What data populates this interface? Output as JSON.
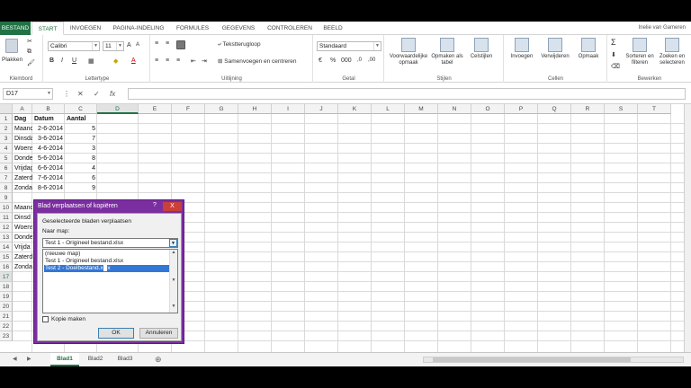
{
  "ribbon_tabs": [
    "BESTAND",
    "START",
    "INVOEGEN",
    "PAGINA-INDELING",
    "FORMULES",
    "GEGEVENS",
    "CONTROLEREN",
    "BEELD"
  ],
  "user_name": "Inelie van Gameren",
  "ribbon": {
    "clipboard": {
      "paste": "Plakken",
      "label": "Klembord"
    },
    "font": {
      "name": "Calibri",
      "size": "11",
      "label": "Lettertype"
    },
    "alignment": {
      "wrap": "Tekstterugloop",
      "merge": "Samenvoegen en centreren",
      "label": "Uitlijning"
    },
    "number": {
      "format": "Standaard",
      "label": "Getal"
    },
    "styles": {
      "conditional": "Voorwaardelijke opmaak",
      "table": "Opmaken als tabel",
      "cell": "Celstijlen",
      "label": "Stijlen"
    },
    "cells": {
      "insert": "Invoegen",
      "delete": "Verwijderen",
      "format": "Opmaak",
      "label": "Cellen"
    },
    "editing": {
      "sort": "Sorteren en filteren",
      "find": "Zoeken en selecteren",
      "label": "Bewerken"
    }
  },
  "formula_bar": {
    "name_box": "D17",
    "formula": ""
  },
  "columns": [
    "A",
    "B",
    "C",
    "D",
    "E",
    "F",
    "G",
    "H",
    "I",
    "J",
    "K",
    "L",
    "M",
    "N",
    "O",
    "P",
    "Q",
    "R",
    "S",
    "T"
  ],
  "rows": [
    "1",
    "2",
    "3",
    "4",
    "5",
    "6",
    "7",
    "8",
    "9",
    "10",
    "11",
    "12",
    "13",
    "14",
    "15",
    "16",
    "17",
    "18",
    "19",
    "20",
    "21",
    "22",
    "23"
  ],
  "table1": {
    "headers": [
      "Dag",
      "Datum",
      "Aantal"
    ],
    "rows": [
      [
        "Maandag",
        "2-6-2014",
        "5"
      ],
      [
        "Dinsdag",
        "3-6-2014",
        "7"
      ],
      [
        "Woensdag",
        "4-6-2014",
        "3"
      ],
      [
        "Donderdag",
        "5-6-2014",
        "8"
      ],
      [
        "Vrijdag",
        "6-6-2014",
        "4"
      ],
      [
        "Zaterdag",
        "7-6-2014",
        "6"
      ],
      [
        "Zondag",
        "8-6-2014",
        "9"
      ]
    ]
  },
  "table2_partial": [
    "Maand",
    "Dinsd",
    "Woens",
    "Donde",
    "Vrijda",
    "Zaterd",
    "Zonda"
  ],
  "sheets": [
    "Blad1",
    "Blad2",
    "Blad3"
  ],
  "active_sheet": "Blad1",
  "dialog": {
    "title": "Blad verplaatsen of kopiëren",
    "help": "?",
    "close": "X",
    "section_label": "Geselecteerde bladen verplaatsen",
    "to_book_label": "Naar map:",
    "to_book_value": "Test 1 - Origineel bestand.xlsx",
    "list_items": [
      "(nieuwe map)",
      "Test 1 - Origineel bestand.xlsx",
      "Test 2 - Doelbestand.xlsx"
    ],
    "selected_index": 2,
    "copy_label": "Kopie maken",
    "copy_checked": false,
    "ok": "OK",
    "cancel": "Annuleren"
  },
  "colors": {
    "excel_green": "#217346",
    "dialog_border": "#7b2ea0",
    "selection": "#3377d6"
  }
}
